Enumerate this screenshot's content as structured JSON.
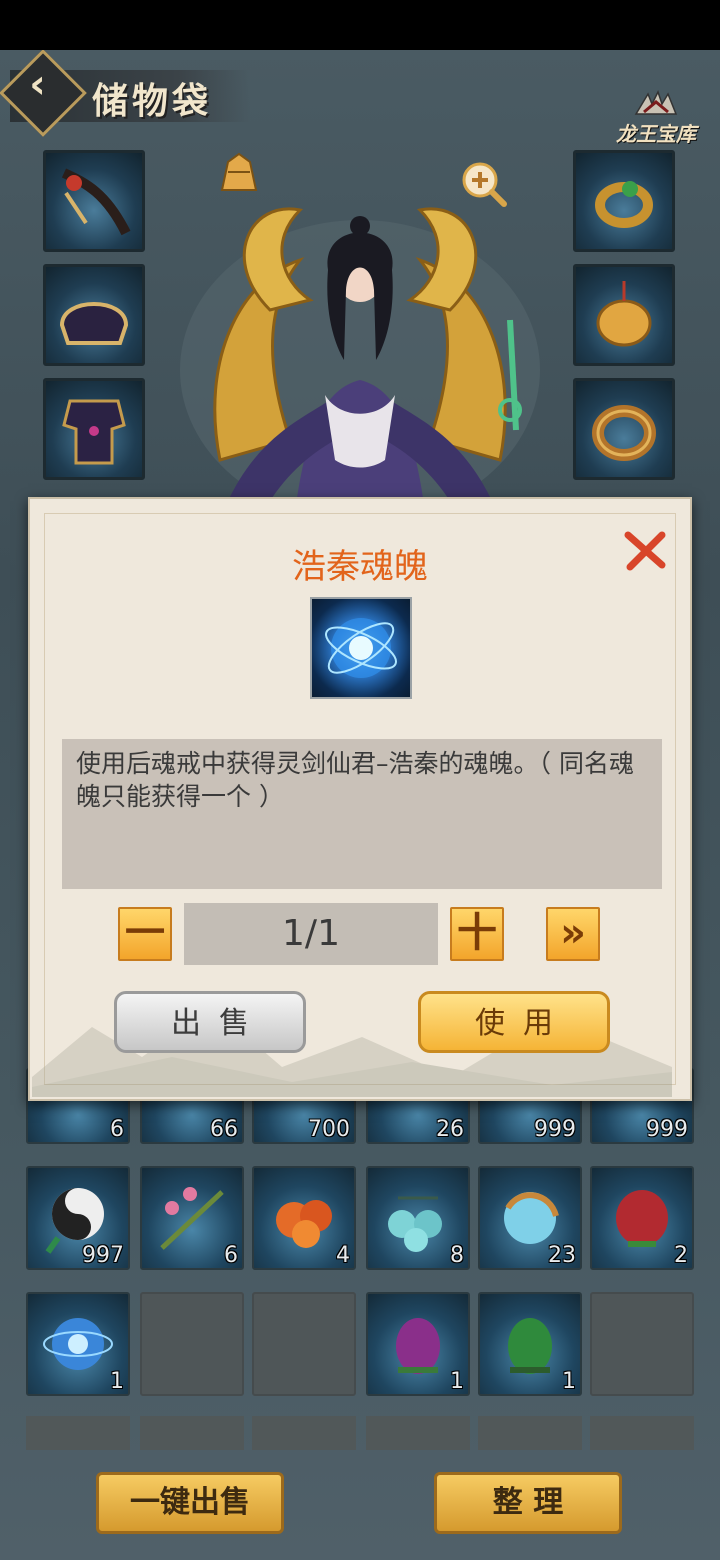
{
  "header": {
    "title": "储物袋",
    "back_icon": "chevron-left-icon",
    "vault_label": "龙王宝库"
  },
  "character": {
    "zoom_icon": "zoom-in-icon",
    "outfit_icon": "outfit-icon"
  },
  "equipment": {
    "left": [
      "weapon-icon",
      "helmet-icon",
      "armor-icon"
    ],
    "right": [
      "ring-icon",
      "jade-pendant-icon",
      "bracelet-icon"
    ]
  },
  "modal": {
    "title": "浩秦魂魄",
    "item_icon": "soul-orb-icon",
    "description": "使用后魂戒中获得灵剑仙君–浩秦的魂魄。（ 同名魂魄只能获得一个 ）",
    "minus_label": "一",
    "plus_label": "十",
    "max_label": "»",
    "quantity": "1/1",
    "sell_label": "出售",
    "use_label": "使用",
    "close_icon": "close-icon",
    "title_color": "#e2641b"
  },
  "inventory": {
    "row1_counts": [
      "6",
      "66",
      "700",
      "26",
      "999",
      "999"
    ],
    "row2": [
      {
        "icon": "yin-yang-icon",
        "count": "997"
      },
      {
        "icon": "herb-icon",
        "count": "6"
      },
      {
        "icon": "fruit-icon",
        "count": "4"
      },
      {
        "icon": "berries-icon",
        "count": "8"
      },
      {
        "icon": "spirit-orb-icon",
        "count": "23"
      },
      {
        "icon": "red-fruit-icon",
        "count": "2"
      }
    ],
    "row3": [
      {
        "icon": "soul-orb-icon",
        "count": "1"
      },
      {
        "icon": "",
        "count": ""
      },
      {
        "icon": "",
        "count": ""
      },
      {
        "icon": "purple-egg-icon",
        "count": "1"
      },
      {
        "icon": "green-egg-icon",
        "count": "1"
      },
      {
        "icon": "",
        "count": ""
      }
    ]
  },
  "footer": {
    "sell_all_label": "一键出售",
    "sort_label": "整 理"
  }
}
